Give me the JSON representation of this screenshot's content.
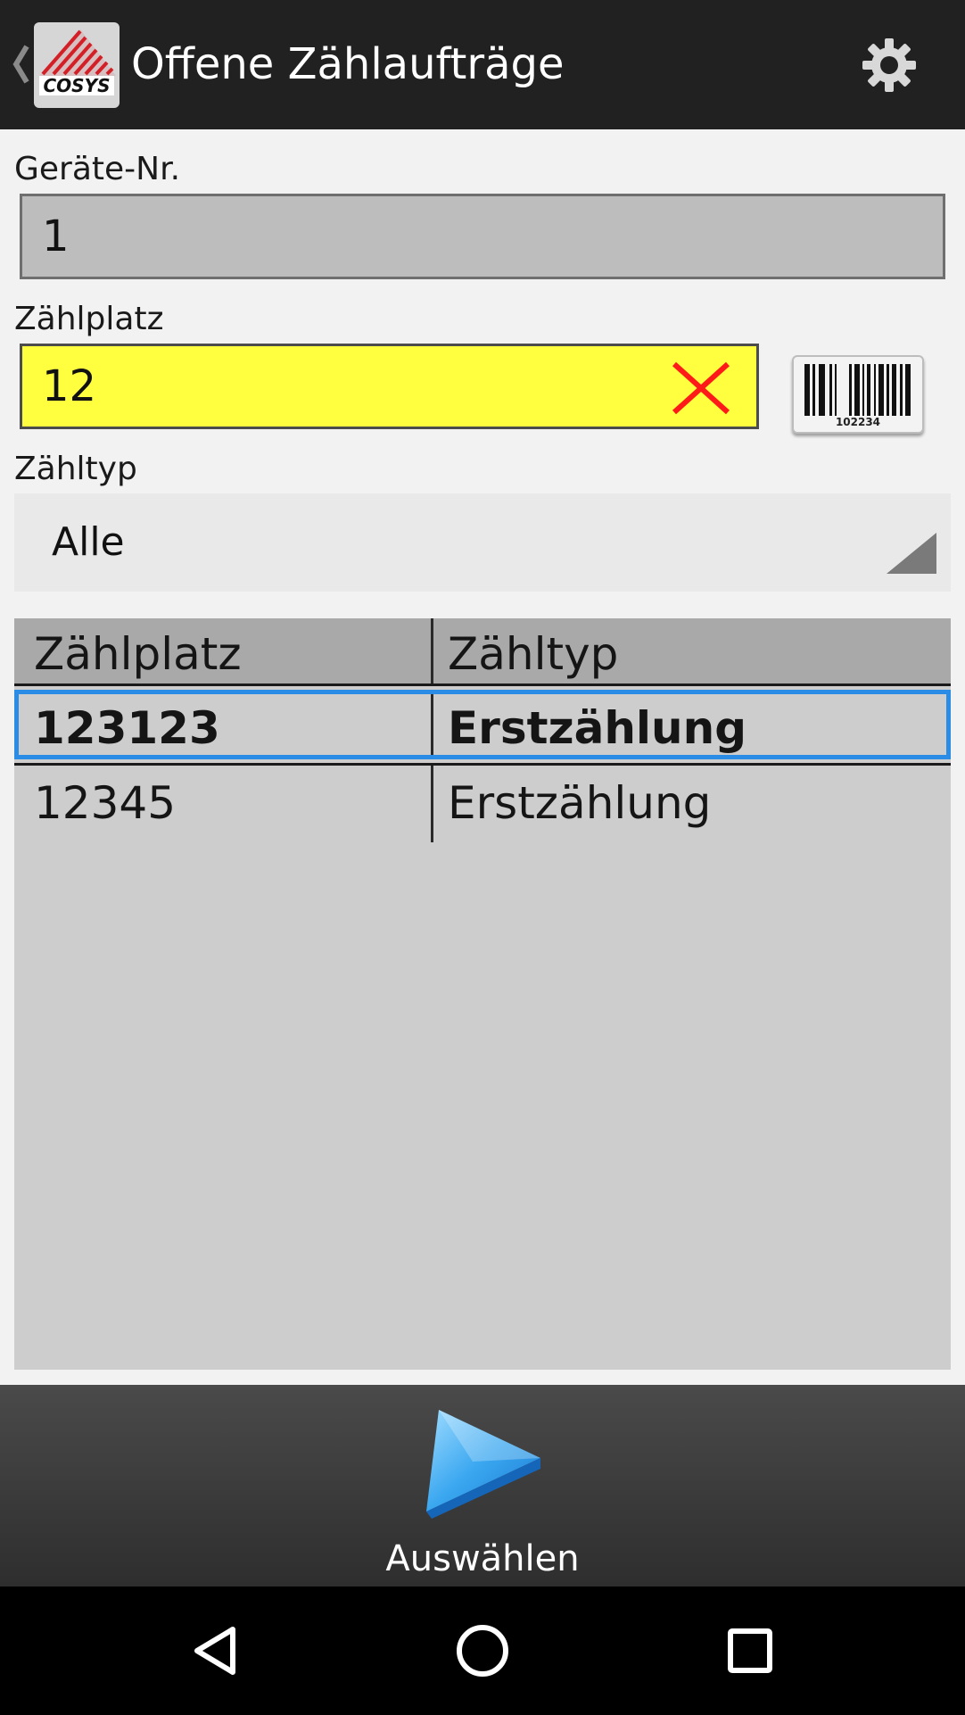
{
  "actionbar": {
    "title": "Offene Zählaufträge",
    "logo_text": "COSYS",
    "icons": {
      "back": "chevron-left-icon",
      "logo": "cosys-logo",
      "settings": "gear-icon"
    }
  },
  "form": {
    "device_number": {
      "label": "Geräte-Nr.",
      "value": "1"
    },
    "count_location": {
      "label": "Zählplatz",
      "value": "12",
      "clear_icon": "clear-x-icon",
      "scan_icon": "barcode-icon",
      "barcode_number": "102234"
    },
    "count_type": {
      "label": "Zähltyp",
      "selected": "Alle",
      "arrow_icon": "spinner-corner-arrow-icon"
    }
  },
  "table": {
    "headers": [
      "Zählplatz",
      "Zähltyp"
    ],
    "rows": [
      {
        "zaehlplatz": "123123",
        "zaehltyp": "Erstzählung",
        "selected": true
      },
      {
        "zaehlplatz": "12345",
        "zaehltyp": "Erstzählung",
        "selected": false
      }
    ]
  },
  "bottom_action": {
    "label": "Auswählen",
    "icon": "play-arrow-icon"
  },
  "navbar": {
    "icons": [
      "nav-back-icon",
      "nav-home-icon",
      "nav-recents-icon"
    ]
  },
  "colors": {
    "actionbar": "#212121",
    "active_field": "#ffff40",
    "selection_border": "#2b8ce6",
    "table_background": "#cdcdcd",
    "table_header": "#a9a9a9",
    "clear_icon": "#ff1a1a"
  }
}
